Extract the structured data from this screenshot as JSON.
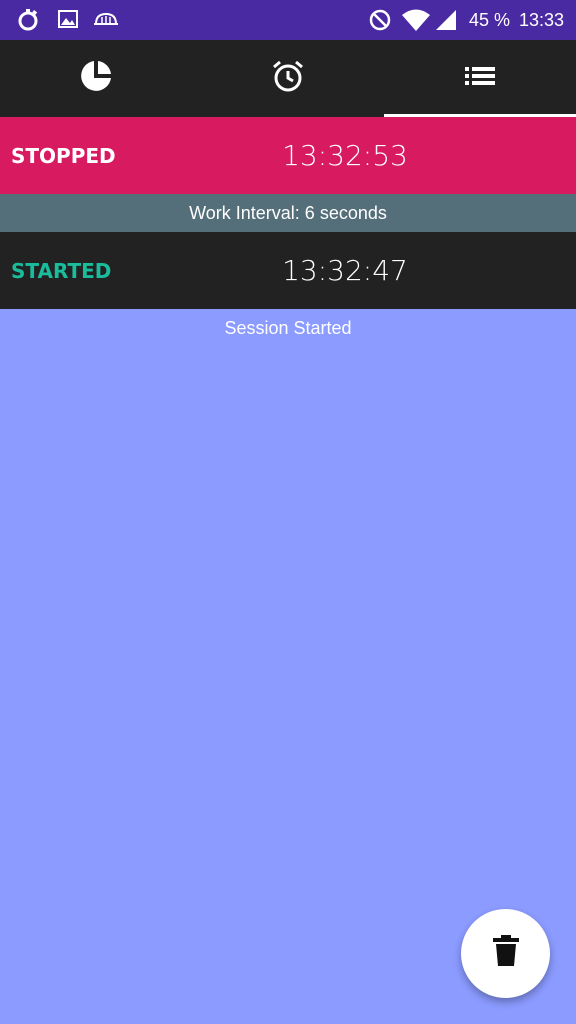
{
  "status_bar": {
    "battery_text": "45 %",
    "clock": "13:33",
    "icons": [
      "stopwatch-icon",
      "image-icon",
      "cloud-icon",
      "do-not-disturb-icon",
      "wifi-icon",
      "signal-icon"
    ]
  },
  "tabs": [
    {
      "icon": "pie-chart-icon",
      "selected": false
    },
    {
      "icon": "alarm-clock-icon",
      "selected": false
    },
    {
      "icon": "list-icon",
      "selected": true
    }
  ],
  "log": {
    "stopped": {
      "label": "STOPPED",
      "time": "13:32:53"
    },
    "interval": {
      "text": "Work Interval: 6 seconds"
    },
    "started": {
      "label": "STARTED",
      "time": "13:32:47"
    },
    "session": {
      "text": "Session Started"
    }
  },
  "fab": {
    "icon": "trash-icon"
  },
  "colors": {
    "status_bar": "#4a2aa3",
    "tab_bar": "#222222",
    "stopped": "#d81b60",
    "interval": "#546e7a",
    "started_label": "#1abc9c",
    "background": "#8b9bff"
  }
}
